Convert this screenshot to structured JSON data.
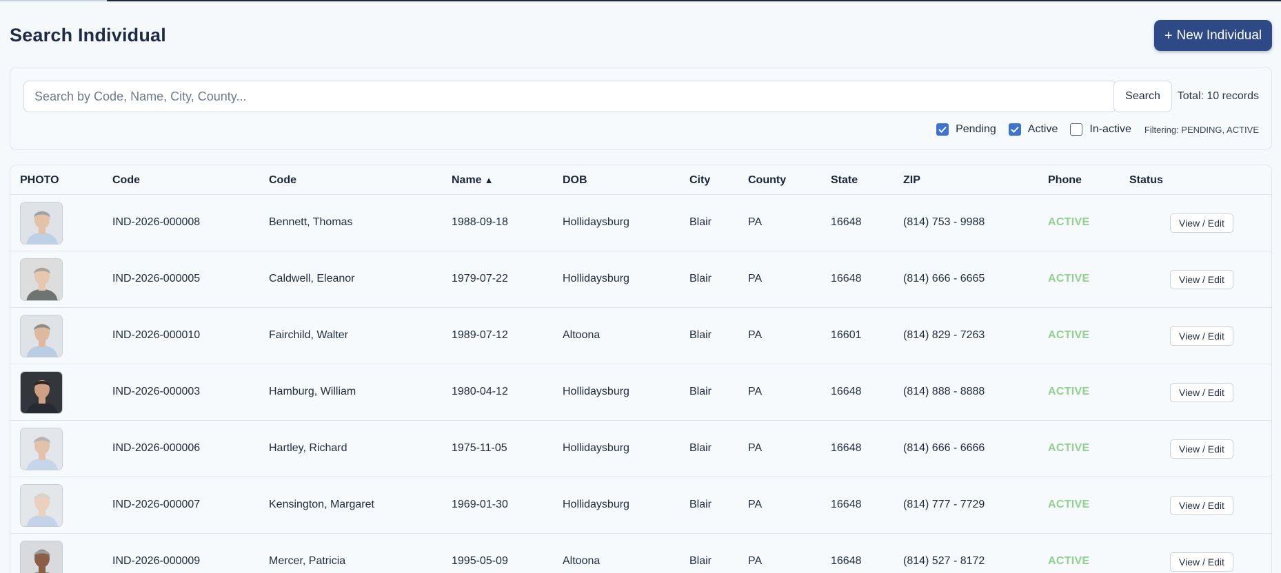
{
  "page": {
    "title": "Search Individual",
    "new_button": {
      "plus": "+",
      "label": "New Individual"
    }
  },
  "filters": {
    "search_placeholder": "Search by Code, Name, City, County...",
    "search_value": "",
    "search_button": "Search",
    "total": "Total: 10 records",
    "checkboxes": [
      {
        "label": "Pending",
        "checked": true
      },
      {
        "label": "Active",
        "checked": true
      },
      {
        "label": "In-active",
        "checked": false
      }
    ],
    "filtering_text": "Filtering: PENDING, ACTIVE"
  },
  "table": {
    "headers": [
      "PHOTO",
      "Code",
      "Code",
      "Name",
      "DOB",
      "City",
      "County",
      "State",
      "ZIP",
      "Phone",
      "Status"
    ],
    "sort_indicator": "▲",
    "action_label": "View / Edit",
    "rows": [
      {
        "code": "IND-2026-000008",
        "name": "Bennett, Thomas",
        "dob": "1988-09-18",
        "city": "Hollidaysburg",
        "county": "Blair",
        "state": "PA",
        "zip": "16648",
        "phone": "(814) 753 - 9988",
        "status": "ACTIVE"
      },
      {
        "code": "IND-2026-000005",
        "name": "Caldwell, Eleanor",
        "dob": "1979-07-22",
        "city": "Hollidaysburg",
        "county": "Blair",
        "state": "PA",
        "zip": "16648",
        "phone": "(814) 666 - 6665",
        "status": "ACTIVE"
      },
      {
        "code": "IND-2026-000010",
        "name": "Fairchild, Walter",
        "dob": "1989-07-12",
        "city": "Altoona",
        "county": "Blair",
        "state": "PA",
        "zip": "16601",
        "phone": "(814) 829 - 7263",
        "status": "ACTIVE"
      },
      {
        "code": "IND-2026-000003",
        "name": "Hamburg, William",
        "dob": "1980-04-12",
        "city": "Hollidaysburg",
        "county": "Blair",
        "state": "PA",
        "zip": "16648",
        "phone": "(814) 888 - 8888",
        "status": "ACTIVE"
      },
      {
        "code": "IND-2026-000006",
        "name": "Hartley, Richard",
        "dob": "1975-11-05",
        "city": "Hollidaysburg",
        "county": "Blair",
        "state": "PA",
        "zip": "16648",
        "phone": "(814) 666 - 6666",
        "status": "ACTIVE"
      },
      {
        "code": "IND-2026-000007",
        "name": "Kensington, Margaret",
        "dob": "1969-01-30",
        "city": "Hollidaysburg",
        "county": "Blair",
        "state": "PA",
        "zip": "16648",
        "phone": "(814) 777 - 7729",
        "status": "ACTIVE"
      },
      {
        "code": "IND-2026-000009",
        "name": "Mercer, Patricia",
        "dob": "1995-05-09",
        "city": "Altoona",
        "county": "Blair",
        "state": "PA",
        "zip": "16648",
        "phone": "(814) 527 - 8172",
        "status": "ACTIVE"
      }
    ]
  },
  "colors": {
    "primary": "#2e4a86",
    "checkbox": "#3b73d6",
    "status_active": "#8fd18d",
    "background": "#f6f9fb"
  },
  "icons": {
    "checkmark": "check-icon",
    "sort": "sort-asc-icon"
  }
}
